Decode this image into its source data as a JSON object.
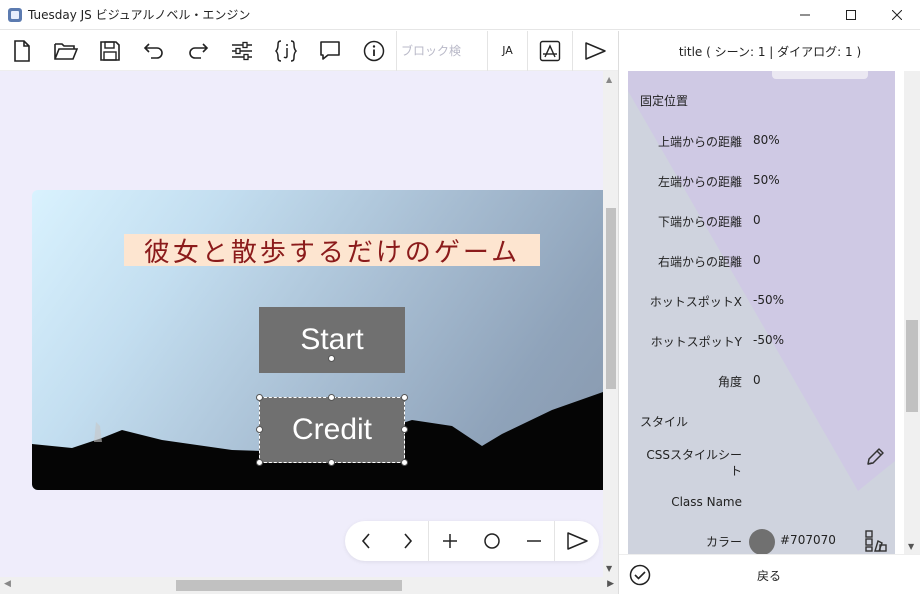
{
  "window": {
    "title": "Tuesday JS ビジュアルノベル・エンジン"
  },
  "toolbar": {
    "icons": [
      "new-file-icon",
      "open-folder-icon",
      "save-icon",
      "undo-icon",
      "redo-icon",
      "settings-sliders-icon",
      "variables-braces-icon",
      "comment-icon",
      "info-icon"
    ],
    "search_placeholder": "ブロック検",
    "lang_label": "JA",
    "extra_icons": [
      "build-app-icon",
      "play-icon"
    ]
  },
  "preview": {
    "game_title": "彼女と散歩するだけのゲーム",
    "start_label": "Start",
    "credit_label": "Credit"
  },
  "nav_controls": {
    "icons": [
      "chevron-left-icon",
      "chevron-right-icon",
      "zoom-in-icon",
      "zoom-reset-icon",
      "zoom-out-icon",
      "play-icon"
    ]
  },
  "panel": {
    "header": "title ( シーン: 1 | ダイアログ: 1 )",
    "section_fixed": "固定位置",
    "props": [
      {
        "label": "上端からの距離",
        "value": "80%"
      },
      {
        "label": "左端からの距離",
        "value": "50%"
      },
      {
        "label": "下端からの距離",
        "value": "0"
      },
      {
        "label": "右端からの距離",
        "value": "0"
      },
      {
        "label": "ホットスポットX",
        "value": "-50%"
      },
      {
        "label": "ホットスポットY",
        "value": "-50%"
      },
      {
        "label": "角度",
        "value": "0"
      }
    ],
    "section_style": "スタイル",
    "css_label_line1": "CSSスタイルシー",
    "css_label_line2": "ト",
    "classname_label": "Class Name",
    "color_label": "カラー",
    "color_value": "#707070",
    "back_label": "戻る"
  }
}
